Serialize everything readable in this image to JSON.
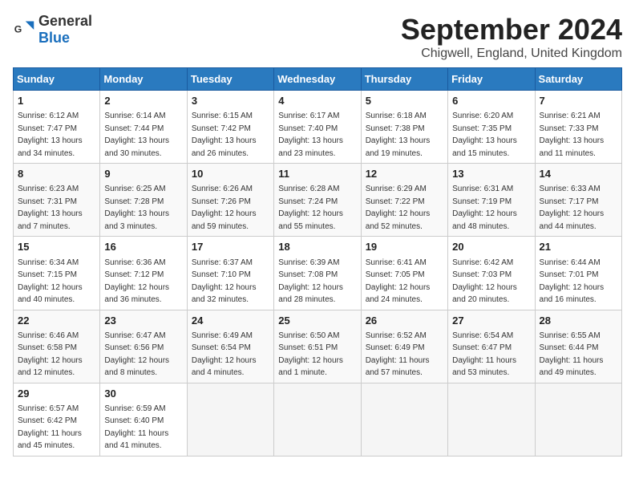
{
  "logo": {
    "text_general": "General",
    "text_blue": "Blue"
  },
  "title": "September 2024",
  "subtitle": "Chigwell, England, United Kingdom",
  "days_of_week": [
    "Sunday",
    "Monday",
    "Tuesday",
    "Wednesday",
    "Thursday",
    "Friday",
    "Saturday"
  ],
  "weeks": [
    [
      {
        "day": "1",
        "sunrise": "6:12 AM",
        "sunset": "7:47 PM",
        "daylight": "13 hours and 34 minutes."
      },
      {
        "day": "2",
        "sunrise": "6:14 AM",
        "sunset": "7:44 PM",
        "daylight": "13 hours and 30 minutes."
      },
      {
        "day": "3",
        "sunrise": "6:15 AM",
        "sunset": "7:42 PM",
        "daylight": "13 hours and 26 minutes."
      },
      {
        "day": "4",
        "sunrise": "6:17 AM",
        "sunset": "7:40 PM",
        "daylight": "13 hours and 23 minutes."
      },
      {
        "day": "5",
        "sunrise": "6:18 AM",
        "sunset": "7:38 PM",
        "daylight": "13 hours and 19 minutes."
      },
      {
        "day": "6",
        "sunrise": "6:20 AM",
        "sunset": "7:35 PM",
        "daylight": "13 hours and 15 minutes."
      },
      {
        "day": "7",
        "sunrise": "6:21 AM",
        "sunset": "7:33 PM",
        "daylight": "13 hours and 11 minutes."
      }
    ],
    [
      {
        "day": "8",
        "sunrise": "6:23 AM",
        "sunset": "7:31 PM",
        "daylight": "13 hours and 7 minutes."
      },
      {
        "day": "9",
        "sunrise": "6:25 AM",
        "sunset": "7:28 PM",
        "daylight": "13 hours and 3 minutes."
      },
      {
        "day": "10",
        "sunrise": "6:26 AM",
        "sunset": "7:26 PM",
        "daylight": "12 hours and 59 minutes."
      },
      {
        "day": "11",
        "sunrise": "6:28 AM",
        "sunset": "7:24 PM",
        "daylight": "12 hours and 55 minutes."
      },
      {
        "day": "12",
        "sunrise": "6:29 AM",
        "sunset": "7:22 PM",
        "daylight": "12 hours and 52 minutes."
      },
      {
        "day": "13",
        "sunrise": "6:31 AM",
        "sunset": "7:19 PM",
        "daylight": "12 hours and 48 minutes."
      },
      {
        "day": "14",
        "sunrise": "6:33 AM",
        "sunset": "7:17 PM",
        "daylight": "12 hours and 44 minutes."
      }
    ],
    [
      {
        "day": "15",
        "sunrise": "6:34 AM",
        "sunset": "7:15 PM",
        "daylight": "12 hours and 40 minutes."
      },
      {
        "day": "16",
        "sunrise": "6:36 AM",
        "sunset": "7:12 PM",
        "daylight": "12 hours and 36 minutes."
      },
      {
        "day": "17",
        "sunrise": "6:37 AM",
        "sunset": "7:10 PM",
        "daylight": "12 hours and 32 minutes."
      },
      {
        "day": "18",
        "sunrise": "6:39 AM",
        "sunset": "7:08 PM",
        "daylight": "12 hours and 28 minutes."
      },
      {
        "day": "19",
        "sunrise": "6:41 AM",
        "sunset": "7:05 PM",
        "daylight": "12 hours and 24 minutes."
      },
      {
        "day": "20",
        "sunrise": "6:42 AM",
        "sunset": "7:03 PM",
        "daylight": "12 hours and 20 minutes."
      },
      {
        "day": "21",
        "sunrise": "6:44 AM",
        "sunset": "7:01 PM",
        "daylight": "12 hours and 16 minutes."
      }
    ],
    [
      {
        "day": "22",
        "sunrise": "6:46 AM",
        "sunset": "6:58 PM",
        "daylight": "12 hours and 12 minutes."
      },
      {
        "day": "23",
        "sunrise": "6:47 AM",
        "sunset": "6:56 PM",
        "daylight": "12 hours and 8 minutes."
      },
      {
        "day": "24",
        "sunrise": "6:49 AM",
        "sunset": "6:54 PM",
        "daylight": "12 hours and 4 minutes."
      },
      {
        "day": "25",
        "sunrise": "6:50 AM",
        "sunset": "6:51 PM",
        "daylight": "12 hours and 1 minute."
      },
      {
        "day": "26",
        "sunrise": "6:52 AM",
        "sunset": "6:49 PM",
        "daylight": "11 hours and 57 minutes."
      },
      {
        "day": "27",
        "sunrise": "6:54 AM",
        "sunset": "6:47 PM",
        "daylight": "11 hours and 53 minutes."
      },
      {
        "day": "28",
        "sunrise": "6:55 AM",
        "sunset": "6:44 PM",
        "daylight": "11 hours and 49 minutes."
      }
    ],
    [
      {
        "day": "29",
        "sunrise": "6:57 AM",
        "sunset": "6:42 PM",
        "daylight": "11 hours and 45 minutes."
      },
      {
        "day": "30",
        "sunrise": "6:59 AM",
        "sunset": "6:40 PM",
        "daylight": "11 hours and 41 minutes."
      },
      null,
      null,
      null,
      null,
      null
    ]
  ]
}
